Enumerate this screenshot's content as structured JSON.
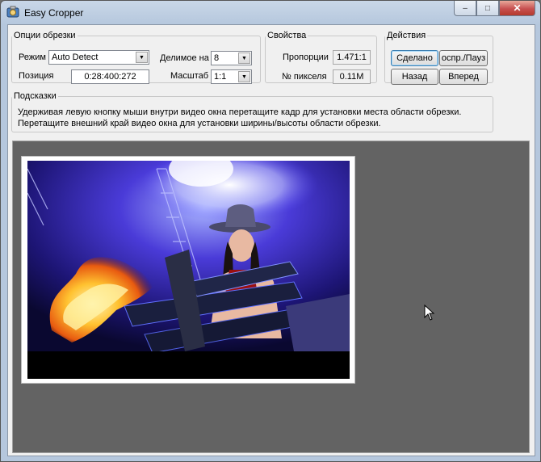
{
  "window": {
    "title": "Easy Cropper",
    "controls": {
      "minimize": "–",
      "maximize": "□",
      "close": "✕"
    }
  },
  "crop_options": {
    "legend": "Опции обрезки",
    "mode_label": "Режим",
    "mode_value": "Auto Detect",
    "divisible_label": "Делимое на",
    "divisible_value": "8",
    "position_label": "Позиция",
    "position_value": "0:28:400:272",
    "scale_label": "Масштаб",
    "scale_value": "1:1"
  },
  "properties": {
    "legend": "Свойства",
    "ratio_label": "Пропорции",
    "ratio_value": "1.471:1",
    "pixel_label": "№ пикселя",
    "pixel_value": "0.11M"
  },
  "actions": {
    "legend": "Действия",
    "done_label": "Сделано",
    "play_pause_label": "оспр./Пауз",
    "back_label": "Назад",
    "forward_label": "Вперед"
  },
  "hints": {
    "legend": "Подсказки",
    "line1": "Удерживая левую кнопку мыши внутри видео окна перетащите кадр для установки места области обрезки.",
    "line2": "Перетащите внешний край видео окна для установки ширины/высоты области обрезки."
  },
  "icons": {
    "app": "app-icon",
    "dropdown": "chevron-down-icon",
    "cursor": "mouse-pointer-icon"
  }
}
